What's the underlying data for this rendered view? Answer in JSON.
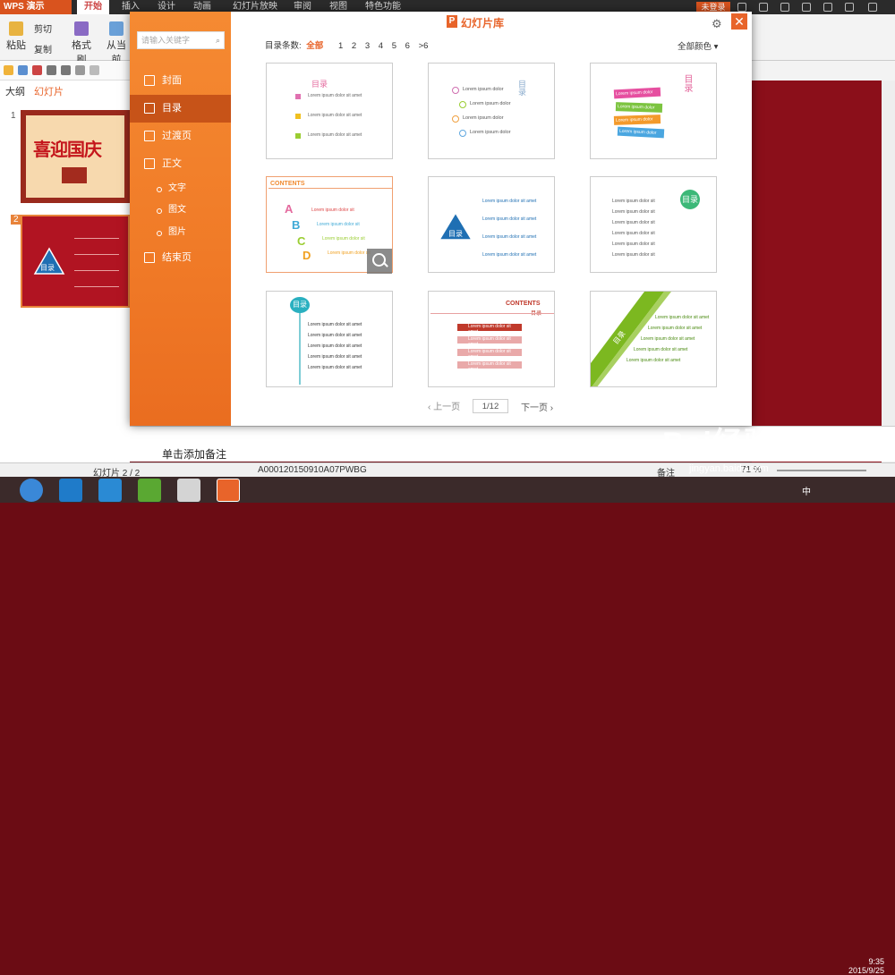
{
  "titlebar": {
    "app": "WPS 演示",
    "tabs": [
      "开始",
      "插入",
      "设计",
      "动画",
      "幻灯片放映",
      "审阅",
      "视图",
      "特色功能"
    ],
    "login": "未登录"
  },
  "ribbon": {
    "paste": "粘贴",
    "cut": "剪切",
    "copy": "复制",
    "format_painter": "格式刷",
    "from_current": "从当前"
  },
  "left_pane": {
    "tabs": [
      "大纲",
      "幻灯片"
    ],
    "slide1_num": "1",
    "slide2_num": "2",
    "slide1_title": "喜迎国庆",
    "slide2_badge": "目录"
  },
  "modal": {
    "title": "幻灯片库",
    "search_placeholder": "请输入关键字",
    "categories": [
      {
        "label": "封面",
        "icon": "cover-icon"
      },
      {
        "label": "目录",
        "icon": "toc-icon"
      },
      {
        "label": "过渡页",
        "icon": "transition-icon"
      },
      {
        "label": "正文",
        "icon": "body-icon"
      }
    ],
    "subcategories": [
      "文字",
      "图文",
      "图片"
    ],
    "end_category": {
      "label": "结束页",
      "icon": "end-icon"
    },
    "filter": {
      "label": "目录条数:",
      "all": "全部",
      "pages": [
        "1",
        "2",
        "3",
        "4",
        "5",
        "6",
        ">6"
      ]
    },
    "color_filter": "全部颜色",
    "pagination": {
      "prev": "上一页",
      "current": "1/12",
      "next": "下一页"
    },
    "templates": [
      {
        "title": "目录",
        "text": "Lorem ipsum dolor sit amet"
      },
      {
        "title": "目录",
        "text": "Lorem ipsum dolor"
      },
      {
        "title": "目录",
        "text": "Lorem ipsum dolor"
      },
      {
        "title": "CONTENTS",
        "text": "Lorem ipsum dolor sit"
      },
      {
        "title": "目录",
        "text": "Lorem ipsum dolor sit amet"
      },
      {
        "title": "目录",
        "text": "Lorem ipsum dolor sit"
      },
      {
        "title": "目录",
        "text": "Lorem ipsum dolor sit amet"
      },
      {
        "title": "CONTENTS",
        "sub": "目录",
        "text": "Lorem ipsum dolor sit amet"
      },
      {
        "title": "目录",
        "text": "Lorem ipsum dolor sit amet"
      }
    ]
  },
  "notes": {
    "placeholder": "单击添加备注"
  },
  "status": {
    "slide_count": "幻灯片 2 / 2",
    "doc_id": "A000120150910A07PWBG",
    "notes_btn": "备注",
    "zoom": "71 %"
  },
  "watermark": {
    "brand": "Bai经验",
    "url": "jingyan.baidu.com"
  },
  "taskbar": {
    "time": "9:35",
    "date": "2015/9/25",
    "ime": "中"
  },
  "colors": {
    "accent": "#e8642a",
    "sidebar": "#f07a27",
    "sidebar_selected": "#c75318",
    "slide_bg": "#b11422"
  }
}
